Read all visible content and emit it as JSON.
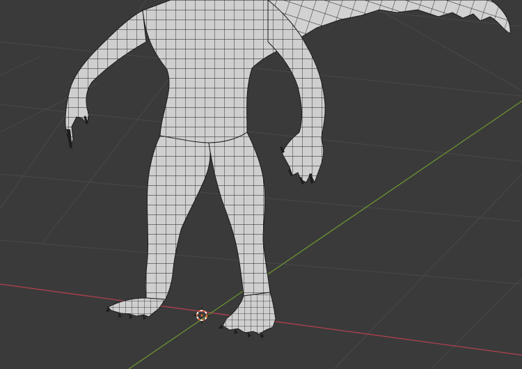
{
  "viewport": {
    "mode": "3d-viewport",
    "shading": "solid-wireframe",
    "background_color": "#3a3a3a",
    "grid_line_color": "#474747",
    "x_axis_color": "#b0414d",
    "y_axis_color": "#6c9430",
    "mesh_fill_color": "#cfcfcf",
    "mesh_wire_color": "#1b1b1b",
    "cursor_color": "#ef6f3a"
  },
  "scene": {
    "object": "creature-mesh",
    "visible_parts": [
      "torso",
      "left-arm",
      "right-arm",
      "left-leg",
      "right-leg",
      "left-foot",
      "right-foot",
      "wing-edge",
      "head-edge"
    ],
    "cursor_icon": "3d-cursor-icon"
  }
}
